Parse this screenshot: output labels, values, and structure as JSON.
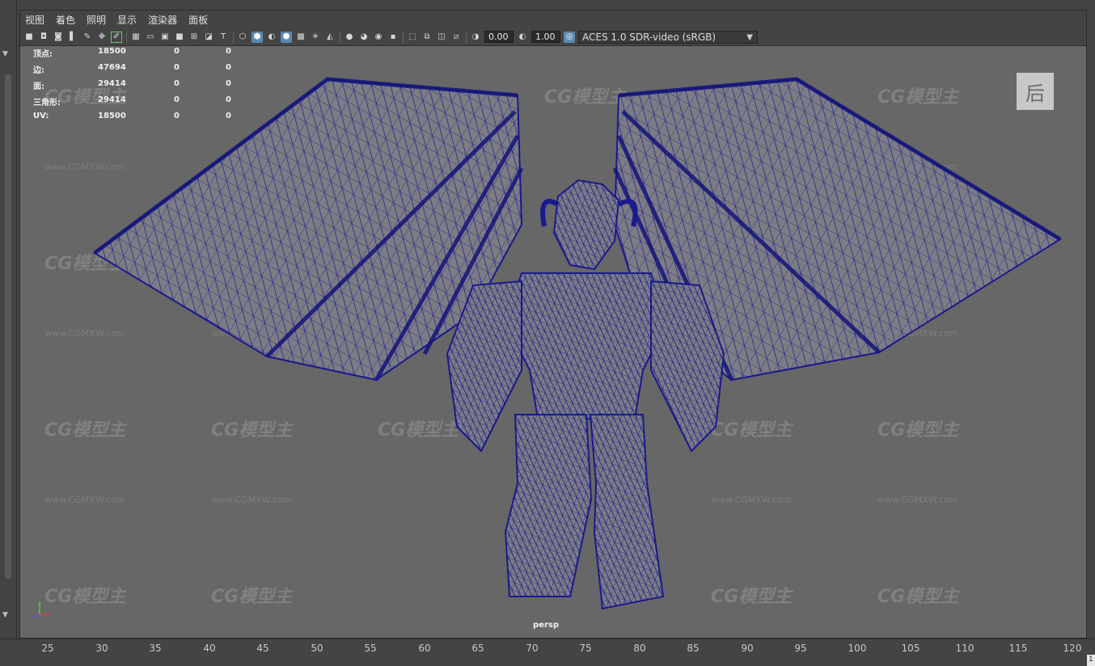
{
  "menu": [
    "视图",
    "着色",
    "照明",
    "显示",
    "渲染器",
    "面板"
  ],
  "toolbar": {
    "field_a": "0.00",
    "field_b": "1.00",
    "color_management": "ACES 1.0 SDR-video (sRGB)",
    "icons": [
      "camera-attributes-icon",
      "bookmark-camera-icon",
      "image-plane-icon",
      "2d-pan-icon",
      "grease-pencil-icon",
      "grid-icon",
      "film-gate-icon",
      "resolution-gate-icon",
      "gate-mask-icon",
      "field-chart-icon",
      "safe-action-icon",
      "safe-title-icon",
      "wireframe-icon",
      "smooth-shade-icon",
      "default-material-icon",
      "wireframe-on-shaded-icon",
      "textured-icon",
      "use-all-lights-icon",
      "shadows-icon",
      "screen-space-ao-icon",
      "motion-blur-icon",
      "anti-aliasing-icon",
      "depth-of-field-icon",
      "isolate-select-icon",
      "xray-icon",
      "xray-joints-icon",
      "xray-components-icon",
      "exposure-icon",
      "gamma-icon",
      "color-management-icon"
    ],
    "accent_color": "#5c88b0"
  },
  "hud": {
    "rows": [
      {
        "label": "顶点:",
        "v1": "18500",
        "v2": "0",
        "v3": "0"
      },
      {
        "label": "边:",
        "v1": "47694",
        "v2": "0",
        "v3": "0"
      },
      {
        "label": "面:",
        "v1": "29414",
        "v2": "0",
        "v3": "0"
      },
      {
        "label": "三角形:",
        "v1": "29414",
        "v2": "0",
        "v3": "0"
      },
      {
        "label": "UV:",
        "v1": "18500",
        "v2": "0",
        "v3": "0"
      }
    ]
  },
  "viewport": {
    "camera": "persp",
    "view_cube": "后",
    "wireframe_color": "#1a1a8c",
    "background_color": "#676767"
  },
  "watermark": {
    "logo_text": "CG模型主",
    "url_text": "www.CGMXW.com"
  },
  "timeline": {
    "ticks": [
      "25",
      "30",
      "35",
      "40",
      "45",
      "50",
      "55",
      "60",
      "65",
      "70",
      "75",
      "80",
      "85",
      "90",
      "95",
      "100",
      "105",
      "110",
      "115",
      "120"
    ],
    "current_frame": "1"
  }
}
